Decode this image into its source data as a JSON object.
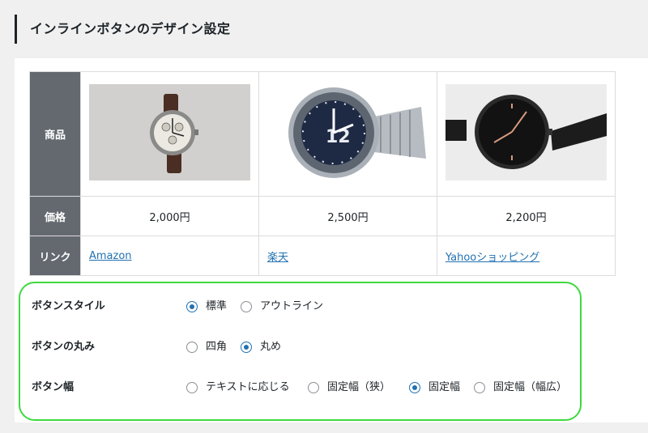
{
  "section": {
    "title": "インラインボタンのデザイン設定"
  },
  "table": {
    "headers": {
      "product": "商品",
      "price": "価格",
      "link": "リンク"
    },
    "products": [
      {
        "image": "chronograph-watch-brown-strap",
        "price": "2,000円",
        "link": "Amazon"
      },
      {
        "image": "steel-dive-watch-blue-dial",
        "price": "2,500円",
        "link": "楽天"
      },
      {
        "image": "black-minimal-watch",
        "price": "2,200円",
        "link": "Yahooショッピング"
      }
    ]
  },
  "settings": {
    "button_style": {
      "label": "ボタンスタイル",
      "options": [
        {
          "label": "標準",
          "checked": true
        },
        {
          "label": "アウトライン",
          "checked": false
        }
      ]
    },
    "button_roundness": {
      "label": "ボタンの丸み",
      "options": [
        {
          "label": "四角",
          "checked": false
        },
        {
          "label": "丸め",
          "checked": true
        }
      ]
    },
    "button_width": {
      "label": "ボタン幅",
      "options": [
        {
          "label": "テキストに応じる",
          "checked": false
        },
        {
          "label": "固定幅（狭）",
          "checked": false
        },
        {
          "label": "固定幅",
          "checked": true
        },
        {
          "label": "固定幅（幅広）",
          "checked": false
        }
      ]
    }
  },
  "colors": {
    "highlight_border": "#3fd83f",
    "link": "#2271b1",
    "header_bg": "#646970",
    "radio_checked": "#2271b1"
  }
}
